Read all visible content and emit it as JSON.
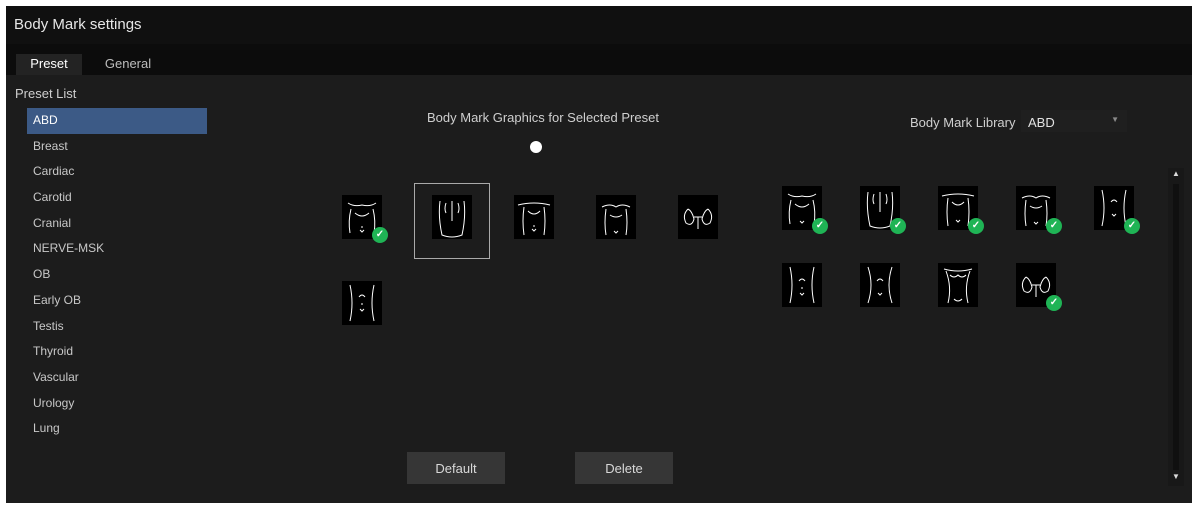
{
  "window": {
    "title": "Body Mark settings"
  },
  "tabs": [
    {
      "label": "Preset",
      "active": true
    },
    {
      "label": "General",
      "active": false
    }
  ],
  "preset_list": {
    "title": "Preset List",
    "selected": "ABD",
    "items": [
      "ABD",
      "Breast",
      "Cardiac",
      "Carotid",
      "Cranial",
      "NERVE-MSK",
      "OB",
      "Early OB",
      "Testis",
      "Thyroid",
      "Vascular",
      "Urology",
      "Lung"
    ]
  },
  "selected_graphics": {
    "title": "Body Mark Graphics for Selected Preset",
    "thumbnails": [
      {
        "icon": "abdomen-upper-icon",
        "default": true
      },
      {
        "icon": "back-icon",
        "selected": true
      },
      {
        "icon": "chest-icon"
      },
      {
        "icon": "chest-upper-icon"
      },
      {
        "icon": "kidneys-icon"
      },
      {
        "icon": "abdomen-side-icon"
      }
    ]
  },
  "library": {
    "label": "Body Mark Library",
    "value": "ABD",
    "thumbnails": [
      {
        "icon": "abdomen-upper-icon",
        "added": true
      },
      {
        "icon": "back-icon",
        "added": true
      },
      {
        "icon": "chest-icon",
        "added": true
      },
      {
        "icon": "chest-upper-icon",
        "added": true
      },
      {
        "icon": "abdomen-side-icon",
        "added": true
      },
      {
        "icon": "abdomen-left-icon",
        "added": false
      },
      {
        "icon": "abdomen-right-icon",
        "added": false
      },
      {
        "icon": "torso-icon",
        "added": false
      },
      {
        "icon": "kidneys-icon",
        "added": true
      }
    ]
  },
  "buttons": {
    "default_label": "Default",
    "delete_label": "Delete"
  },
  "colors": {
    "selected_item": "#3c5a86",
    "check_green": "#1fb455",
    "background": "#1c1c1c"
  }
}
